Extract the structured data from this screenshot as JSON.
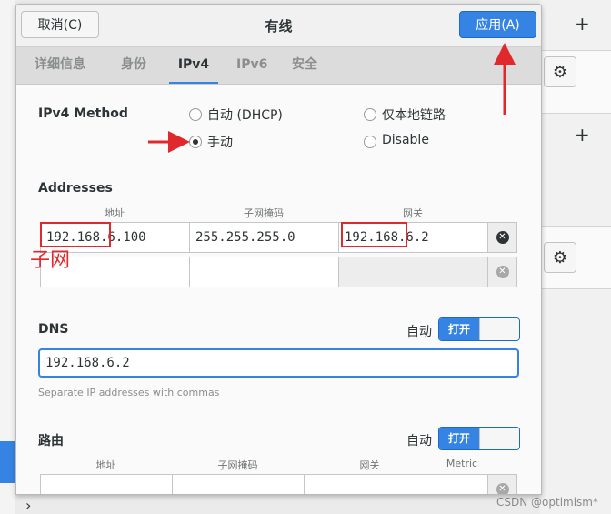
{
  "background": {
    "plus_icon": "+",
    "gear_icon": "⚙",
    "chevron_icon": "›",
    "watermark": "CSDN @optimism*"
  },
  "dialog": {
    "title": "有线",
    "cancel_label": "取消(C)",
    "apply_label": "应用(A)",
    "tabs": [
      {
        "label": "详细信息",
        "active": false
      },
      {
        "label": "身份",
        "active": false
      },
      {
        "label": "IPv4",
        "active": true
      },
      {
        "label": "IPv6",
        "active": false
      },
      {
        "label": "安全",
        "active": false
      }
    ]
  },
  "ipv4": {
    "method_label": "IPv4 Method",
    "methods": [
      {
        "label": "自动 (DHCP)",
        "checked": false
      },
      {
        "label": "仅本地链路",
        "checked": false
      },
      {
        "label": "手动",
        "checked": true
      },
      {
        "label": "Disable",
        "checked": false
      }
    ]
  },
  "addresses": {
    "section_label": "Addresses",
    "headers": [
      "地址",
      "子网掩码",
      "网关"
    ],
    "rows": [
      {
        "address": "192.168.6.100",
        "netmask": "255.255.255.0",
        "gateway": "192.168.6.2"
      },
      {
        "address": "",
        "netmask": "",
        "gateway": ""
      }
    ],
    "clear_icon": "✕"
  },
  "dns": {
    "section_label": "DNS",
    "auto_label": "自动",
    "toggle_on": "打开",
    "value": "192.168.6.2",
    "hint": "Separate IP addresses with commas"
  },
  "routes": {
    "section_label": "路由",
    "auto_label": "自动",
    "toggle_on": "打开",
    "headers": [
      "地址",
      "子网掩码",
      "网关",
      "Metric"
    ]
  },
  "annotations": {
    "subnet_note": "子网",
    "color": "#e0292c"
  }
}
